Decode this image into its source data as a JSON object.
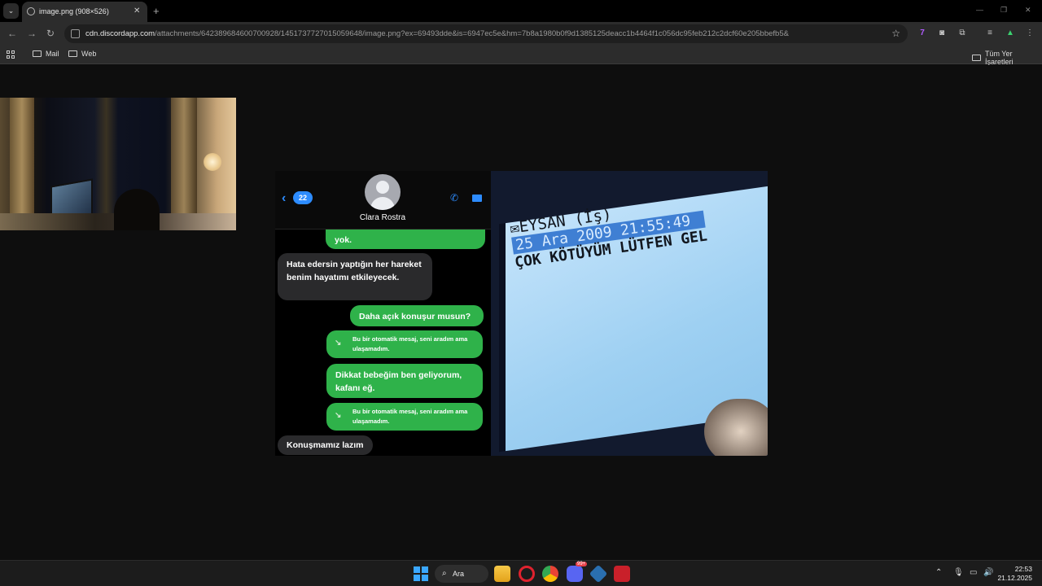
{
  "browser": {
    "tab_title": "image.png (908×526)",
    "tab_close": "✕",
    "new_tab": "+",
    "url_host": "cdn.discordapp.com",
    "url_path": "/attachments/642389684600700928/1451737727015059648/image.png?ex=69493dde&is=6947ec5e&hm=7b8a1980b0f9d1385125deacc1b4464f1c056dc95feb212c2dcf60e205bbefb5&",
    "bookmarks": [
      {
        "label": "Mail"
      },
      {
        "label": "Web"
      }
    ],
    "all_bookmarks": "Tüm Yer İşaretleri"
  },
  "chat": {
    "unread_count": "22",
    "contact_name": "Clara Rostra",
    "messages": [
      {
        "side": "out",
        "text": "yok."
      },
      {
        "side": "in",
        "text": "Hata edersin yaptığın her hareket benim hayatımı etkileyecek."
      },
      {
        "side": "out",
        "text": "Daha açık konuşur musun?"
      },
      {
        "side": "out",
        "auto": true,
        "text": "Bu bir otomatik mesaj, seni aradım ama ulaşamadım."
      },
      {
        "side": "out",
        "text": "Dikkat bebeğim ben geliyorum, kafanı eğ."
      },
      {
        "side": "out",
        "auto": true,
        "text": "Bu bir otomatik mesaj, seni aradım ama ulaşamadım."
      },
      {
        "side": "in",
        "text": "Konuşmamız lazım"
      }
    ]
  },
  "phone_sms": {
    "sender": "EYSAN (İş)",
    "datetime": "25 Ara 2009 21:55:49",
    "message": "ÇOK KÖTÜYÜM LÜTFEN GEL"
  },
  "taskbar": {
    "search_label": "Ara",
    "time": "22:53",
    "date": "21.12.2025",
    "discord_badge": "99+"
  },
  "colors": {
    "imessage_green": "#2fb24a",
    "ios_blue": "#2d8cff",
    "windows_blue": "#3aa7ff"
  }
}
